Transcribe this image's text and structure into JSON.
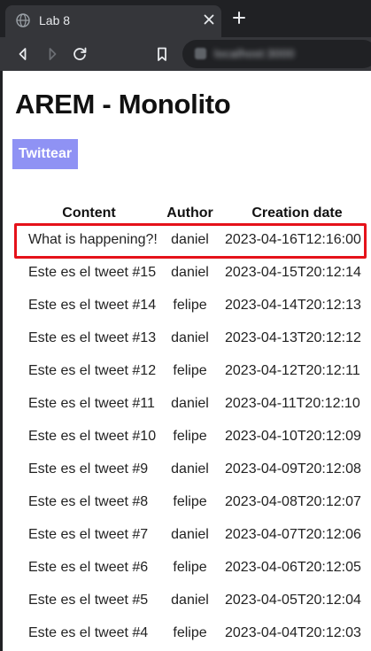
{
  "browser": {
    "tab_title": "Lab 8",
    "url": "localhost:3000"
  },
  "page": {
    "title": "AREM - Monolito",
    "tweet_button": "Twittear"
  },
  "table": {
    "headers": [
      "Content",
      "Author",
      "Creation date"
    ],
    "rows": [
      {
        "content": "What is happening?!",
        "author": "daniel",
        "date": "2023-04-16T12:16:00"
      },
      {
        "content": "Este es el tweet #15",
        "author": "daniel",
        "date": "2023-04-15T20:12:14"
      },
      {
        "content": "Este es el tweet #14",
        "author": "felipe",
        "date": "2023-04-14T20:12:13"
      },
      {
        "content": "Este es el tweet #13",
        "author": "daniel",
        "date": "2023-04-13T20:12:12"
      },
      {
        "content": "Este es el tweet #12",
        "author": "felipe",
        "date": "2023-04-12T20:12:11"
      },
      {
        "content": "Este es el tweet #11",
        "author": "daniel",
        "date": "2023-04-11T20:12:10"
      },
      {
        "content": "Este es el tweet #10",
        "author": "felipe",
        "date": "2023-04-10T20:12:09"
      },
      {
        "content": "Este es el tweet #9",
        "author": "daniel",
        "date": "2023-04-09T20:12:08"
      },
      {
        "content": "Este es el tweet #8",
        "author": "felipe",
        "date": "2023-04-08T20:12:07"
      },
      {
        "content": "Este es el tweet #7",
        "author": "daniel",
        "date": "2023-04-07T20:12:06"
      },
      {
        "content": "Este es el tweet #6",
        "author": "felipe",
        "date": "2023-04-06T20:12:05"
      },
      {
        "content": "Este es el tweet #5",
        "author": "daniel",
        "date": "2023-04-05T20:12:04"
      },
      {
        "content": "Este es el tweet #4",
        "author": "felipe",
        "date": "2023-04-04T20:12:03"
      }
    ]
  },
  "colors": {
    "button": "#8f92f4",
    "highlight": "#e5121a"
  }
}
